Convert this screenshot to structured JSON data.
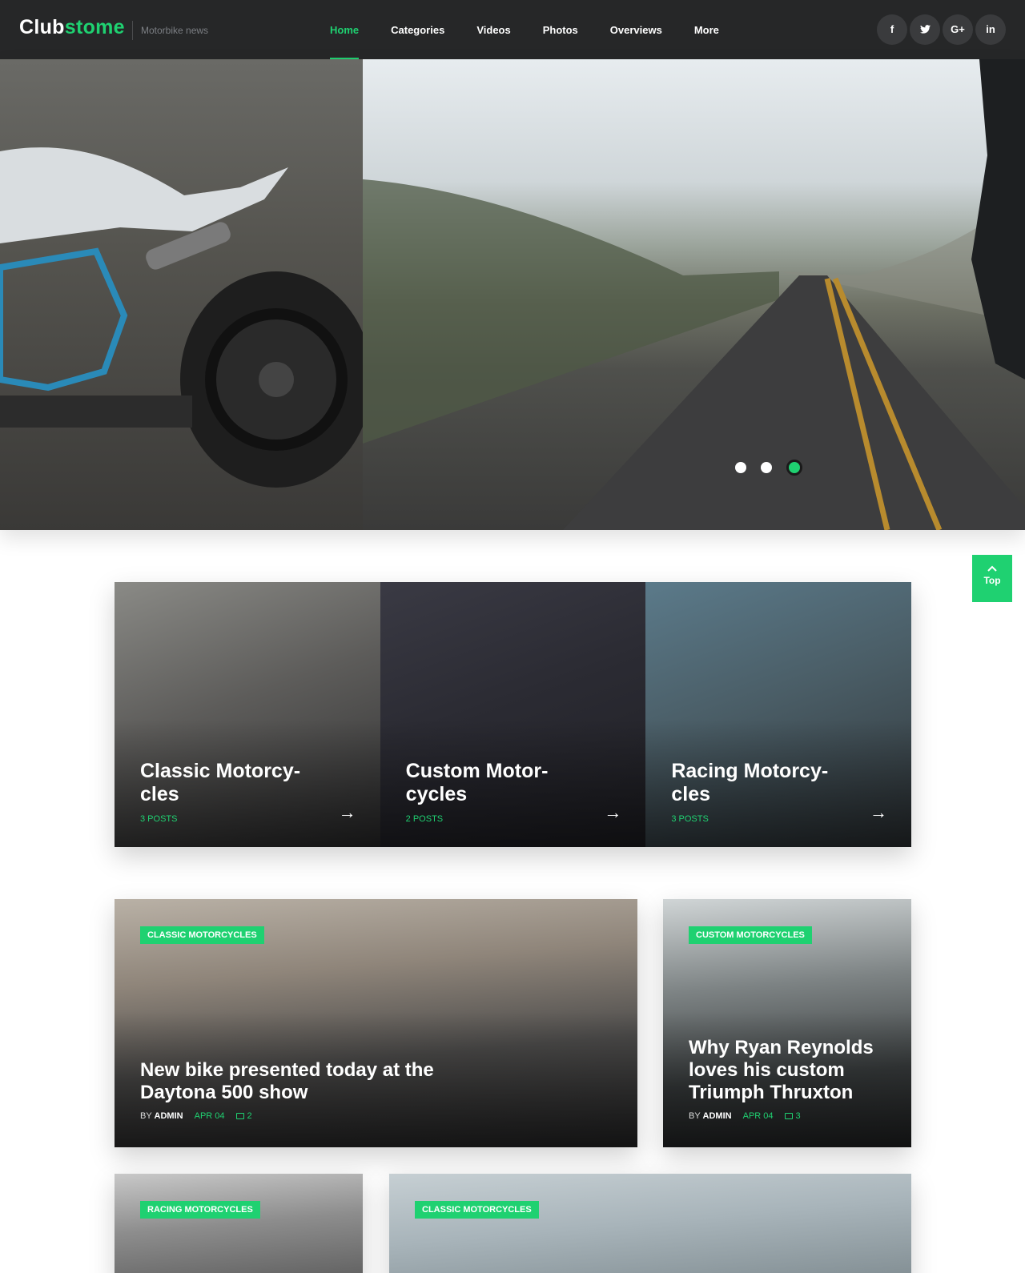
{
  "header": {
    "logo_main": "Club",
    "logo_accent": "stome",
    "tagline": "Motorbike news",
    "nav": [
      "Home",
      "Categories",
      "Videos",
      "Photos",
      "Overviews",
      "More"
    ],
    "socials": [
      "f",
      "t",
      "G+",
      "in"
    ]
  },
  "hero": {
    "slides": 3,
    "active_slide": 3
  },
  "top_button": {
    "label": "Top",
    "icon": "chevron-up-icon"
  },
  "categories": [
    {
      "title": "Classic Motorcy-cles",
      "count": "3 POSTS"
    },
    {
      "title": "Custom Motor-cycles",
      "count": "2 POSTS"
    },
    {
      "title": "Racing Motorcy-cles",
      "count": "3 POSTS"
    }
  ],
  "posts": [
    {
      "tag": "CLASSIC MOTORCYCLES",
      "title": "New bike presented today at the Daytona 500 show",
      "by": "BY",
      "author": "ADMIN",
      "date": "APR 04",
      "comments": "2"
    },
    {
      "tag": "CUSTOM MOTORCYCLES",
      "title": "Why Ryan Reynolds loves his custom Triumph Thruxton",
      "by": "BY",
      "author": "ADMIN",
      "date": "APR 04",
      "comments": "3"
    },
    {
      "tag": "RACING MOTORCYCLES"
    },
    {
      "tag": "CLASSIC MOTORCYCLES"
    }
  ],
  "colors": {
    "accent": "#1fd171",
    "header_bg": "#262728"
  }
}
